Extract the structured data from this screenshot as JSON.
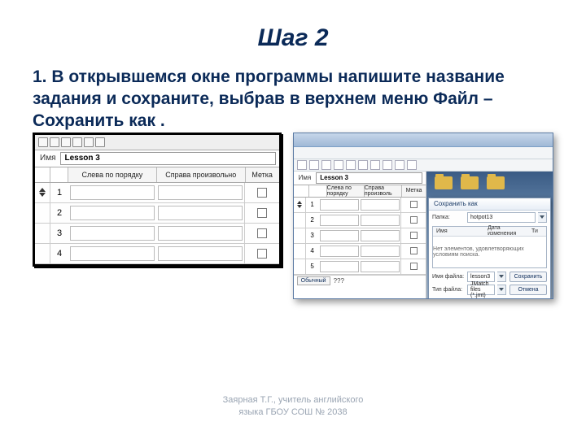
{
  "title": "Шаг 2",
  "paragraph": "1. В открывшемся окне программы напишите название задания и сохраните, выбрав в верхнем меню Файл – Сохранить как .",
  "left_window": {
    "name_label": "Имя",
    "title_field": "Lesson 3",
    "col_left": "Слева по порядку",
    "col_right": "Справа произвольно",
    "col_mark": "Метка",
    "rows": [
      "1",
      "2",
      "3",
      "4"
    ]
  },
  "right_window": {
    "name_label": "Имя",
    "title_field": "Lesson 3",
    "col_left": "Слева по порядку",
    "col_right": "Справа произволь",
    "col_mark": "Метка",
    "rows": [
      "1",
      "2",
      "3",
      "4",
      "5"
    ],
    "status_button": "Обычный",
    "status_q": "???"
  },
  "save_dialog": {
    "title": "Сохранить как",
    "folder_label": "Папка:",
    "folder_value": "hotpot13",
    "list_head_name": "Имя",
    "list_head_date": "Дата изменения",
    "list_head_type": "Ти",
    "empty_text": "Нет элементов, удовлетворяющих условиям поиска.",
    "filename_label": "Имя файла:",
    "filename_value": "lesson3",
    "filetype_label": "Тип файла:",
    "filetype_value": "JMatch files (*.jmt)",
    "save_btn": "Сохранить",
    "cancel_btn": "Отмена"
  },
  "footer_line1": "Заярная Т.Г., учитель английского",
  "footer_line2": "языка ГБОУ СОШ № 2038"
}
